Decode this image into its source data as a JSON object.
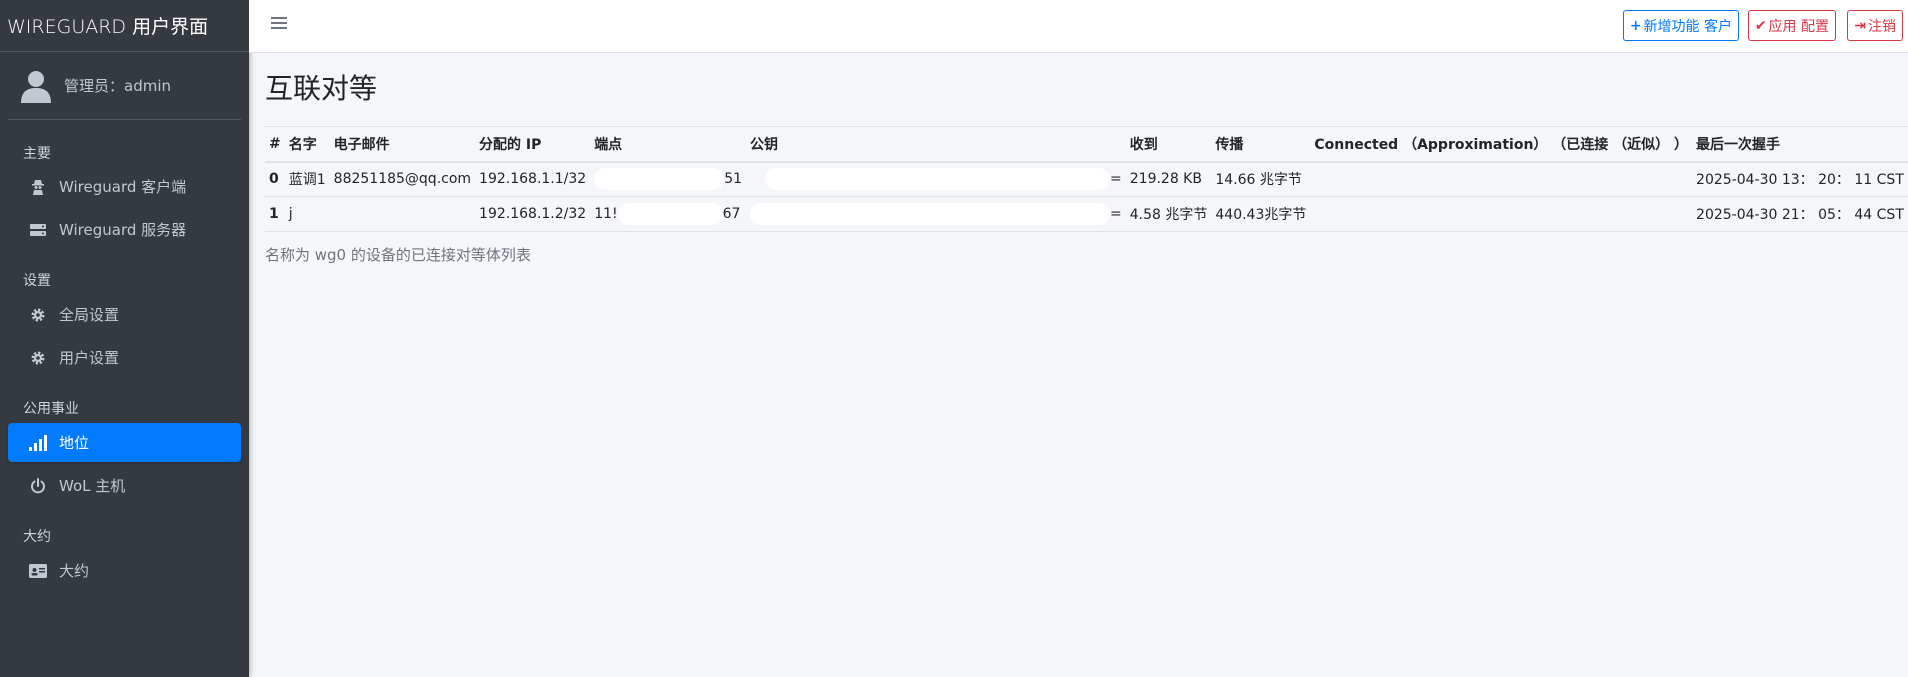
{
  "brand": {
    "title": "WIREGUARD 用户界面"
  },
  "user": {
    "label": "管理员：admin"
  },
  "sidebar": {
    "sections": [
      {
        "header": "主要",
        "items": [
          {
            "label": "Wireguard 客户端",
            "icon": "user-secret-icon"
          },
          {
            "label": "Wireguard 服务器",
            "icon": "server-icon"
          }
        ]
      },
      {
        "header": "设置",
        "items": [
          {
            "label": "全局设置",
            "icon": "gear-icon"
          },
          {
            "label": "用户设置",
            "icon": "gear-icon"
          }
        ]
      },
      {
        "header": "公用事业",
        "items": [
          {
            "label": "地位",
            "icon": "signal-icon",
            "active": true
          },
          {
            "label": "WoL 主机",
            "icon": "power-icon"
          }
        ]
      },
      {
        "header": "大约",
        "items": [
          {
            "label": "大约",
            "icon": "id-card-icon"
          }
        ]
      }
    ]
  },
  "toolbar": {
    "new_client": "新增功能 客户",
    "apply_config": "应用 配置",
    "logout": "注销"
  },
  "page": {
    "title": "互联对等",
    "caption": "名称为 wg0 的设备的已连接对等体列表"
  },
  "table": {
    "headers": [
      "#",
      "名字",
      "电子邮件",
      "分配的 IP",
      "端点",
      "公钥",
      "收到",
      "传播",
      "Connected （Approximation） （已连接 （近似） ）",
      "最后一次握手"
    ],
    "rows": [
      {
        "idx": "0",
        "name": "蓝调1",
        "email": "88251185@qq.com",
        "ip": "192.168.1.1/32",
        "endpoint_start": "",
        "endpoint_end": "51",
        "pubkey_end": "=",
        "received": "219.28 KB",
        "sent": "14.66 兆字节",
        "connected": "",
        "handshake": "2025-04-30 13： 20： 11 CST"
      },
      {
        "idx": "1",
        "name": "j",
        "email": "",
        "ip": "192.168.1.2/32",
        "endpoint_start": "11!",
        "endpoint_end": "67",
        "pubkey_end": "=",
        "received": "4.58 兆字节",
        "sent": "440.43兆字节",
        "connected": "",
        "handshake": "2025-04-30 21： 05： 44 CST"
      }
    ]
  },
  "colors": {
    "sidebar_bg": "#343a40",
    "accent": "#007bff",
    "danger": "#dc3545"
  }
}
